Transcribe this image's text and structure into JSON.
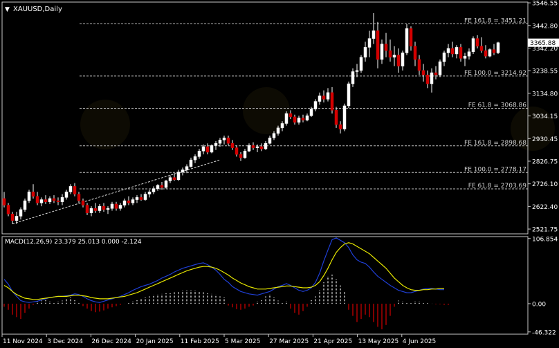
{
  "chart_data": [
    {
      "type": "candlestick",
      "symbol_label": "XAUUSD,Daily",
      "current_price_label": "3365.88",
      "y_ticks": [
        "3546.55",
        "3442.80",
        "3342.20",
        "3238.55",
        "3134.80",
        "3034.15",
        "2930.45",
        "2826.75",
        "2726.10",
        "2622.40",
        "2521.75"
      ],
      "x_ticks": [
        "11 Nov 2024",
        "3 Dec 2024",
        "26 Dec 2024",
        "20 Jan 2025",
        "11 Feb 2025",
        "5 Mar 2025",
        "27 Mar 2025",
        "21 Apr 2025",
        "13 May 2025",
        "4 Jun 2025"
      ],
      "ylim": [
        2500,
        3550
      ],
      "fib_levels": [
        {
          "label": "FE 161.8 = 3451.21",
          "value": 3451.21
        },
        {
          "label": "FE 100.0 = 3214.92",
          "value": 3214.92
        },
        {
          "label": "FE 61.8 = 3068.86",
          "value": 3068.86
        },
        {
          "label": "FE 161.8 = 2898.68",
          "value": 2898.68
        },
        {
          "label": "FE 100.0 = 2778.17",
          "value": 2778.17
        },
        {
          "label": "FE 61.8 = 2703.69",
          "value": 2703.69
        }
      ],
      "trendline": {
        "from": {
          "bar": 2,
          "price": 2545
        },
        "to": {
          "bar": 52,
          "price": 2835
        }
      },
      "candles": [
        {
          "o": 2660,
          "h": 2690,
          "l": 2620,
          "c": 2630
        },
        {
          "o": 2630,
          "h": 2640,
          "l": 2580,
          "c": 2590
        },
        {
          "o": 2590,
          "h": 2600,
          "l": 2545,
          "c": 2560
        },
        {
          "o": 2560,
          "h": 2600,
          "l": 2545,
          "c": 2580
        },
        {
          "o": 2580,
          "h": 2620,
          "l": 2565,
          "c": 2610
        },
        {
          "o": 2610,
          "h": 2660,
          "l": 2600,
          "c": 2650
        },
        {
          "o": 2650,
          "h": 2700,
          "l": 2640,
          "c": 2690
        },
        {
          "o": 2690,
          "h": 2725,
          "l": 2660,
          "c": 2670
        },
        {
          "o": 2670,
          "h": 2690,
          "l": 2630,
          "c": 2640
        },
        {
          "o": 2640,
          "h": 2665,
          "l": 2625,
          "c": 2655
        },
        {
          "o": 2655,
          "h": 2675,
          "l": 2635,
          "c": 2645
        },
        {
          "o": 2645,
          "h": 2670,
          "l": 2635,
          "c": 2660
        },
        {
          "o": 2660,
          "h": 2675,
          "l": 2640,
          "c": 2650
        },
        {
          "o": 2650,
          "h": 2665,
          "l": 2630,
          "c": 2645
        },
        {
          "o": 2645,
          "h": 2680,
          "l": 2630,
          "c": 2665
        },
        {
          "o": 2665,
          "h": 2700,
          "l": 2655,
          "c": 2690
        },
        {
          "o": 2690,
          "h": 2725,
          "l": 2680,
          "c": 2715
        },
        {
          "o": 2715,
          "h": 2730,
          "l": 2670,
          "c": 2680
        },
        {
          "o": 2680,
          "h": 2690,
          "l": 2640,
          "c": 2650
        },
        {
          "o": 2650,
          "h": 2660,
          "l": 2620,
          "c": 2630
        },
        {
          "o": 2630,
          "h": 2640,
          "l": 2585,
          "c": 2595
        },
        {
          "o": 2595,
          "h": 2625,
          "l": 2580,
          "c": 2615
        },
        {
          "o": 2615,
          "h": 2640,
          "l": 2595,
          "c": 2605
        },
        {
          "o": 2605,
          "h": 2635,
          "l": 2595,
          "c": 2625
        },
        {
          "o": 2625,
          "h": 2640,
          "l": 2600,
          "c": 2610
        },
        {
          "o": 2610,
          "h": 2625,
          "l": 2590,
          "c": 2615
        },
        {
          "o": 2615,
          "h": 2645,
          "l": 2605,
          "c": 2635
        },
        {
          "o": 2635,
          "h": 2645,
          "l": 2605,
          "c": 2615
        },
        {
          "o": 2615,
          "h": 2640,
          "l": 2605,
          "c": 2630
        },
        {
          "o": 2630,
          "h": 2660,
          "l": 2620,
          "c": 2650
        },
        {
          "o": 2650,
          "h": 2670,
          "l": 2630,
          "c": 2640
        },
        {
          "o": 2640,
          "h": 2665,
          "l": 2630,
          "c": 2655
        },
        {
          "o": 2655,
          "h": 2675,
          "l": 2640,
          "c": 2665
        },
        {
          "o": 2665,
          "h": 2680,
          "l": 2650,
          "c": 2655
        },
        {
          "o": 2655,
          "h": 2690,
          "l": 2650,
          "c": 2680
        },
        {
          "o": 2680,
          "h": 2700,
          "l": 2665,
          "c": 2690
        },
        {
          "o": 2690,
          "h": 2715,
          "l": 2680,
          "c": 2705
        },
        {
          "o": 2705,
          "h": 2725,
          "l": 2695,
          "c": 2720
        },
        {
          "o": 2720,
          "h": 2735,
          "l": 2700,
          "c": 2710
        },
        {
          "o": 2710,
          "h": 2745,
          "l": 2705,
          "c": 2740
        },
        {
          "o": 2740,
          "h": 2765,
          "l": 2730,
          "c": 2755
        },
        {
          "o": 2755,
          "h": 2775,
          "l": 2740,
          "c": 2745
        },
        {
          "o": 2745,
          "h": 2790,
          "l": 2740,
          "c": 2780
        },
        {
          "o": 2780,
          "h": 2800,
          "l": 2765,
          "c": 2790
        },
        {
          "o": 2790,
          "h": 2815,
          "l": 2775,
          "c": 2805
        },
        {
          "o": 2805,
          "h": 2845,
          "l": 2800,
          "c": 2835
        },
        {
          "o": 2835,
          "h": 2860,
          "l": 2820,
          "c": 2850
        },
        {
          "o": 2850,
          "h": 2885,
          "l": 2840,
          "c": 2875
        },
        {
          "o": 2875,
          "h": 2905,
          "l": 2860,
          "c": 2895
        },
        {
          "o": 2895,
          "h": 2910,
          "l": 2860,
          "c": 2870
        },
        {
          "o": 2870,
          "h": 2905,
          "l": 2865,
          "c": 2900
        },
        {
          "o": 2900,
          "h": 2920,
          "l": 2880,
          "c": 2910
        },
        {
          "o": 2910,
          "h": 2935,
          "l": 2895,
          "c": 2925
        },
        {
          "o": 2925,
          "h": 2945,
          "l": 2905,
          "c": 2935
        },
        {
          "o": 2935,
          "h": 2945,
          "l": 2900,
          "c": 2910
        },
        {
          "o": 2910,
          "h": 2925,
          "l": 2880,
          "c": 2890
        },
        {
          "o": 2890,
          "h": 2900,
          "l": 2850,
          "c": 2860
        },
        {
          "o": 2860,
          "h": 2870,
          "l": 2830,
          "c": 2845
        },
        {
          "o": 2845,
          "h": 2885,
          "l": 2840,
          "c": 2875
        },
        {
          "o": 2875,
          "h": 2910,
          "l": 2870,
          "c": 2900
        },
        {
          "o": 2900,
          "h": 2915,
          "l": 2880,
          "c": 2890
        },
        {
          "o": 2890,
          "h": 2905,
          "l": 2870,
          "c": 2895
        },
        {
          "o": 2895,
          "h": 2910,
          "l": 2875,
          "c": 2885
        },
        {
          "o": 2885,
          "h": 2920,
          "l": 2880,
          "c": 2910
        },
        {
          "o": 2910,
          "h": 2945,
          "l": 2905,
          "c": 2935
        },
        {
          "o": 2935,
          "h": 2965,
          "l": 2925,
          "c": 2955
        },
        {
          "o": 2955,
          "h": 2990,
          "l": 2945,
          "c": 2980
        },
        {
          "o": 2980,
          "h": 3010,
          "l": 2965,
          "c": 3000
        },
        {
          "o": 3000,
          "h": 3055,
          "l": 2990,
          "c": 3045
        },
        {
          "o": 3045,
          "h": 3060,
          "l": 3020,
          "c": 3030
        },
        {
          "o": 3030,
          "h": 3040,
          "l": 2995,
          "c": 3005
        },
        {
          "o": 3005,
          "h": 3035,
          "l": 2995,
          "c": 3025
        },
        {
          "o": 3025,
          "h": 3040,
          "l": 3005,
          "c": 3015
        },
        {
          "o": 3015,
          "h": 3045,
          "l": 3010,
          "c": 3035
        },
        {
          "o": 3035,
          "h": 3075,
          "l": 3030,
          "c": 3065
        },
        {
          "o": 3065,
          "h": 3110,
          "l": 3055,
          "c": 3100
        },
        {
          "o": 3100,
          "h": 3140,
          "l": 3085,
          "c": 3125
        },
        {
          "o": 3125,
          "h": 3150,
          "l": 3095,
          "c": 3110
        },
        {
          "o": 3110,
          "h": 3160,
          "l": 3100,
          "c": 3140
        },
        {
          "o": 3140,
          "h": 3165,
          "l": 3045,
          "c": 3060
        },
        {
          "o": 3060,
          "h": 3075,
          "l": 2980,
          "c": 2995
        },
        {
          "o": 2995,
          "h": 3010,
          "l": 2955,
          "c": 2975
        },
        {
          "o": 2975,
          "h": 3090,
          "l": 2965,
          "c": 3080
        },
        {
          "o": 3080,
          "h": 3190,
          "l": 3070,
          "c": 3180
        },
        {
          "o": 3180,
          "h": 3250,
          "l": 3165,
          "c": 3235
        },
        {
          "o": 3235,
          "h": 3270,
          "l": 3210,
          "c": 3240
        },
        {
          "o": 3240,
          "h": 3310,
          "l": 3230,
          "c": 3300
        },
        {
          "o": 3300,
          "h": 3370,
          "l": 3280,
          "c": 3345
        },
        {
          "o": 3345,
          "h": 3420,
          "l": 3300,
          "c": 3385
        },
        {
          "o": 3385,
          "h": 3500,
          "l": 3360,
          "c": 3420
        },
        {
          "o": 3420,
          "h": 3460,
          "l": 3250,
          "c": 3290
        },
        {
          "o": 3290,
          "h": 3380,
          "l": 3270,
          "c": 3360
        },
        {
          "o": 3360,
          "h": 3410,
          "l": 3300,
          "c": 3330
        },
        {
          "o": 3330,
          "h": 3380,
          "l": 3280,
          "c": 3300
        },
        {
          "o": 3300,
          "h": 3350,
          "l": 3260,
          "c": 3310
        },
        {
          "o": 3310,
          "h": 3340,
          "l": 3230,
          "c": 3260
        },
        {
          "o": 3260,
          "h": 3330,
          "l": 3240,
          "c": 3320
        },
        {
          "o": 3320,
          "h": 3450,
          "l": 3310,
          "c": 3430
        },
        {
          "o": 3430,
          "h": 3440,
          "l": 3330,
          "c": 3350
        },
        {
          "o": 3350,
          "h": 3370,
          "l": 3260,
          "c": 3290
        },
        {
          "o": 3290,
          "h": 3310,
          "l": 3220,
          "c": 3240
        },
        {
          "o": 3240,
          "h": 3270,
          "l": 3190,
          "c": 3220
        },
        {
          "o": 3220,
          "h": 3240,
          "l": 3160,
          "c": 3180
        },
        {
          "o": 3180,
          "h": 3250,
          "l": 3140,
          "c": 3230
        },
        {
          "o": 3230,
          "h": 3260,
          "l": 3200,
          "c": 3220
        },
        {
          "o": 3220,
          "h": 3290,
          "l": 3210,
          "c": 3280
        },
        {
          "o": 3280,
          "h": 3330,
          "l": 3260,
          "c": 3320
        },
        {
          "o": 3320,
          "h": 3360,
          "l": 3300,
          "c": 3340
        },
        {
          "o": 3340,
          "h": 3370,
          "l": 3300,
          "c": 3315
        },
        {
          "o": 3315,
          "h": 3355,
          "l": 3295,
          "c": 3345
        },
        {
          "o": 3345,
          "h": 3360,
          "l": 3280,
          "c": 3295
        },
        {
          "o": 3295,
          "h": 3320,
          "l": 3260,
          "c": 3305
        },
        {
          "o": 3305,
          "h": 3340,
          "l": 3290,
          "c": 3325
        },
        {
          "o": 3325,
          "h": 3395,
          "l": 3315,
          "c": 3385
        },
        {
          "o": 3385,
          "h": 3400,
          "l": 3340,
          "c": 3350
        },
        {
          "o": 3350,
          "h": 3390,
          "l": 3320,
          "c": 3330
        },
        {
          "o": 3330,
          "h": 3355,
          "l": 3295,
          "c": 3305
        },
        {
          "o": 3305,
          "h": 3340,
          "l": 3300,
          "c": 3335
        },
        {
          "o": 3335,
          "h": 3360,
          "l": 3310,
          "c": 3320
        },
        {
          "o": 3320,
          "h": 3370,
          "l": 3315,
          "c": 3366
        }
      ]
    },
    {
      "type": "bar",
      "indicator_label": "MACD(12,26,9) 23.379 25.013 0.000 -2.124",
      "y_ticks": [
        "106.854",
        "0.00",
        "-46.322"
      ],
      "ylim": [
        -50,
        110
      ],
      "histogram": [
        -5,
        -10,
        -18,
        -22,
        -25,
        -15,
        -8,
        -2,
        3,
        5,
        6,
        4,
        2,
        3,
        5,
        8,
        10,
        6,
        2,
        -4,
        -8,
        -12,
        -14,
        -13,
        -11,
        -8,
        -6,
        -4,
        -2,
        0,
        2,
        4,
        6,
        8,
        10,
        12,
        14,
        15,
        16,
        17,
        18,
        19,
        20,
        21,
        22,
        22,
        21,
        20,
        19,
        18,
        16,
        14,
        12,
        10,
        -3,
        -6,
        -9,
        -10,
        -8,
        -5,
        -3,
        3,
        6,
        12,
        15,
        10,
        5,
        2,
        3,
        -8,
        -15,
        -18,
        -12,
        -5,
        6,
        12,
        22,
        35,
        45,
        48,
        40,
        30,
        20,
        -10,
        -20,
        -30,
        -25,
        -18,
        -22,
        -30,
        -38,
        -42,
        -35,
        -20,
        -5,
        5,
        3,
        2,
        1,
        4,
        3,
        2,
        1,
        0,
        -1,
        -1,
        -2,
        -2
      ],
      "series": [
        {
          "name": "MACD",
          "color": "#1f3fd6",
          "values": [
            40,
            32,
            20,
            12,
            5,
            3,
            2,
            3,
            4,
            6,
            8,
            10,
            11,
            12,
            12,
            13,
            14,
            16,
            15,
            12,
            8,
            5,
            3,
            2,
            4,
            6,
            8,
            10,
            12,
            15,
            18,
            22,
            25,
            28,
            30,
            32,
            35,
            38,
            42,
            45,
            48,
            52,
            55,
            58,
            60,
            62,
            64,
            66,
            67,
            64,
            60,
            55,
            48,
            40,
            35,
            28,
            24,
            20,
            18,
            16,
            15,
            14,
            16,
            18,
            20,
            24,
            28,
            30,
            33,
            30,
            26,
            22,
            20,
            22,
            26,
            35,
            50,
            70,
            88,
            105,
            108,
            104,
            100,
            92,
            80,
            72,
            68,
            66,
            60,
            52,
            45,
            40,
            35,
            30,
            26,
            22,
            20,
            18,
            18,
            20,
            22,
            24,
            25,
            25,
            24,
            23,
            23
          ]
        },
        {
          "name": "Signal",
          "color": "#e6e600",
          "values": [
            30,
            26,
            20,
            15,
            12,
            9,
            8,
            7,
            7,
            8,
            9,
            10,
            11,
            12,
            12,
            12,
            13,
            14,
            14,
            13,
            12,
            10,
            9,
            8,
            8,
            8,
            9,
            10,
            11,
            12,
            14,
            16,
            18,
            21,
            24,
            27,
            30,
            33,
            36,
            39,
            42,
            45,
            48,
            51,
            54,
            56,
            58,
            60,
            61,
            61,
            60,
            58,
            55,
            51,
            47,
            42,
            38,
            34,
            31,
            28,
            26,
            24,
            24,
            24,
            25,
            26,
            27,
            28,
            29,
            29,
            28,
            27,
            26,
            26,
            27,
            30,
            36,
            46,
            58,
            72,
            84,
            92,
            98,
            100,
            98,
            94,
            90,
            86,
            82,
            76,
            70,
            64,
            58,
            50,
            42,
            36,
            30,
            26,
            23,
            22,
            22,
            23,
            23,
            24,
            24,
            25,
            25
          ]
        }
      ]
    }
  ]
}
